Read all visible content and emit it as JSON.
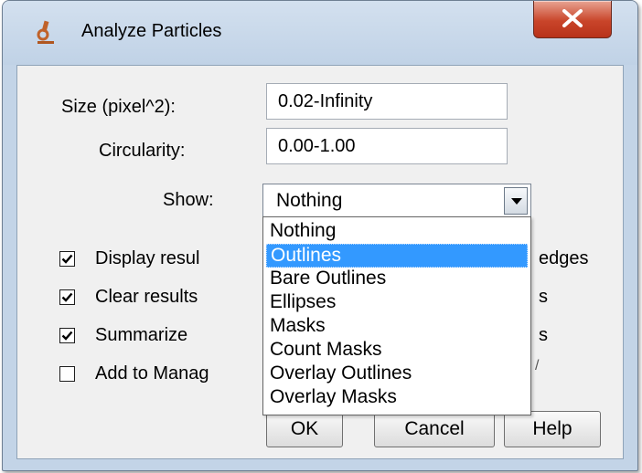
{
  "window": {
    "title": "Analyze Particles",
    "icon": "microscope-icon",
    "close_icon": "close-x-icon"
  },
  "fields": {
    "size_label": "Size (pixel^2):",
    "size_value": "0.02-Infinity",
    "circularity_label": "Circularity:",
    "circularity_value": "0.00-1.00",
    "show_label": "Show:",
    "show_value": "Nothing"
  },
  "checkboxes": [
    {
      "label": "Display resul",
      "checked": true
    },
    {
      "label": "Clear results",
      "checked": true
    },
    {
      "label": "Summarize",
      "checked": true
    },
    {
      "label": "Add to Manag",
      "checked": false
    }
  ],
  "right_column_fragments": [
    "edges",
    "s",
    "s",
    "/"
  ],
  "dropdown": {
    "options": [
      "Nothing",
      "Outlines",
      "Bare Outlines",
      "Ellipses",
      "Masks",
      "Count Masks",
      "Overlay Outlines",
      "Overlay Masks"
    ],
    "highlighted": "Outlines"
  },
  "buttons": {
    "ok": "OK",
    "cancel": "Cancel",
    "help": "Help"
  },
  "colors": {
    "selection": "#3399ff",
    "close_button": "#c9452a",
    "window_frame": "#c3d4e7"
  }
}
